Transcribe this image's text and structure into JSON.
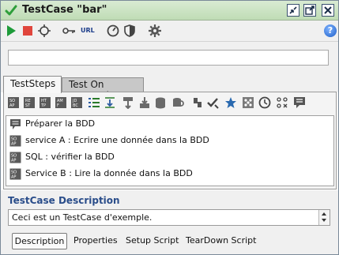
{
  "window": {
    "title": "TestCase \"bar\""
  },
  "toolbar": {
    "url_label": "URL",
    "help_label": "?",
    "icons": [
      "run-icon",
      "stop-icon",
      "target-icon",
      "key-icon",
      "url-icon",
      "gauge-icon",
      "shield-icon",
      "gear-icon",
      "help-icon"
    ]
  },
  "tabs": {
    "active": "TestSteps",
    "inactive": "Test On Demand"
  },
  "steps": [
    {
      "icon": "comment-icon",
      "label": "Préparer la BDD"
    },
    {
      "icon": "soap-request-icon",
      "label": "service A : Ecrire une donnée dans la BDD"
    },
    {
      "icon": "soap-request-icon",
      "label": "SQL : vérifier la BDD"
    },
    {
      "icon": "soap-request-icon",
      "label": "Service B : Lire la donnée dans la BDD"
    }
  ],
  "description": {
    "title": "TestCase Description",
    "text": "Ceci est un TestCase d'exemple."
  },
  "subtabs": {
    "description": "Description",
    "properties": "Properties",
    "setup": "Setup Script",
    "teardown": "TearDown Script"
  },
  "colors": {
    "titlebar": "#bfdcb5",
    "accent_blue": "#2a4d8a",
    "run_green": "#1e9b3a",
    "stop_red": "#e0453c"
  }
}
